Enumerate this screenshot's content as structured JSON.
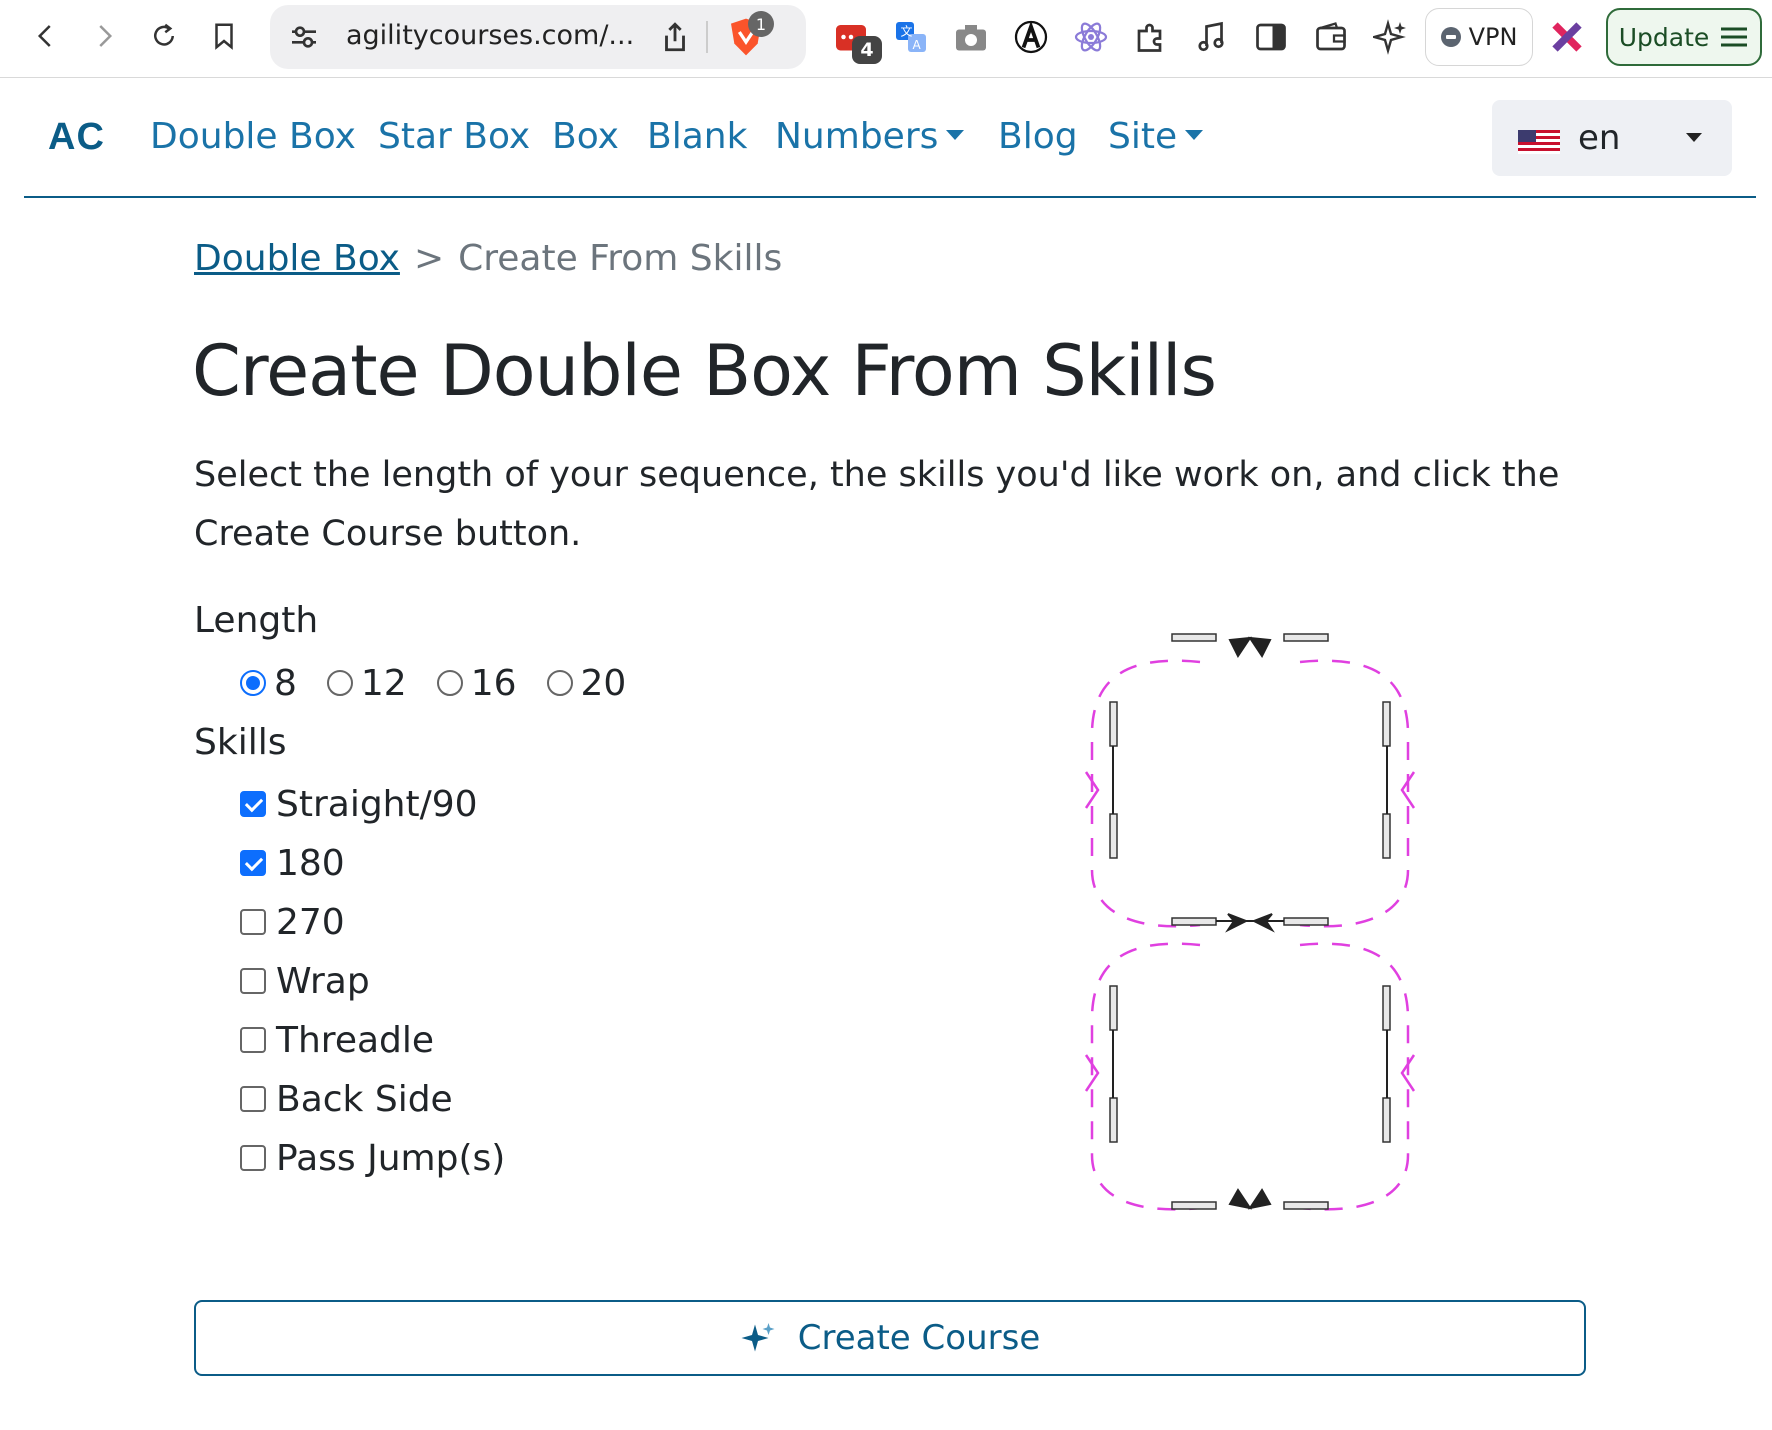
{
  "browser": {
    "url": "agilitycourses.com/...",
    "shield_badge": "1",
    "extension_badge": "4",
    "vpn_label": "VPN",
    "update_label": "Update",
    "icons": [
      "back-icon",
      "forward-icon",
      "reload-icon",
      "bookmark-icon",
      "site-settings-icon",
      "share-icon",
      "brave-shield-icon",
      "calendar-extension-icon",
      "translate-icon",
      "camera-icon",
      "extension-a-icon",
      "atom-icon",
      "puzzle-icon",
      "music-icon",
      "sidebar-icon",
      "wallet-icon",
      "leo-ai-icon",
      "vpn-icon",
      "rewards-icon",
      "menu-icon"
    ]
  },
  "nav": {
    "brand": "AC",
    "links": [
      "Double Box",
      "Star Box",
      "Box",
      "Blank",
      "Numbers",
      "Blog",
      "Site"
    ],
    "dropdowns": [
      "Numbers",
      "Site"
    ],
    "language": "en"
  },
  "breadcrumb": {
    "parent": "Double Box",
    "separator": ">",
    "current": "Create From Skills"
  },
  "main": {
    "title": "Create Double Box From Skills",
    "intro": "Select the length of your sequence, the skills you'd like work on, and click the Create Course button.",
    "length_label": "Length",
    "length_options": [
      "8",
      "12",
      "16",
      "20"
    ],
    "length_selected": "8",
    "skills_label": "Skills",
    "skills": [
      {
        "label": "Straight/90",
        "checked": true
      },
      {
        "label": "180",
        "checked": true
      },
      {
        "label": "270",
        "checked": false
      },
      {
        "label": "Wrap",
        "checked": false
      },
      {
        "label": "Threadle",
        "checked": false
      },
      {
        "label": "Back Side",
        "checked": false
      },
      {
        "label": "Pass Jump(s)",
        "checked": false
      }
    ],
    "create_button": "Create Course"
  },
  "colors": {
    "link": "#1a73a8",
    "brand": "#0b5c87",
    "accent": "#0d6efd",
    "path_dash": "#e040e0"
  }
}
